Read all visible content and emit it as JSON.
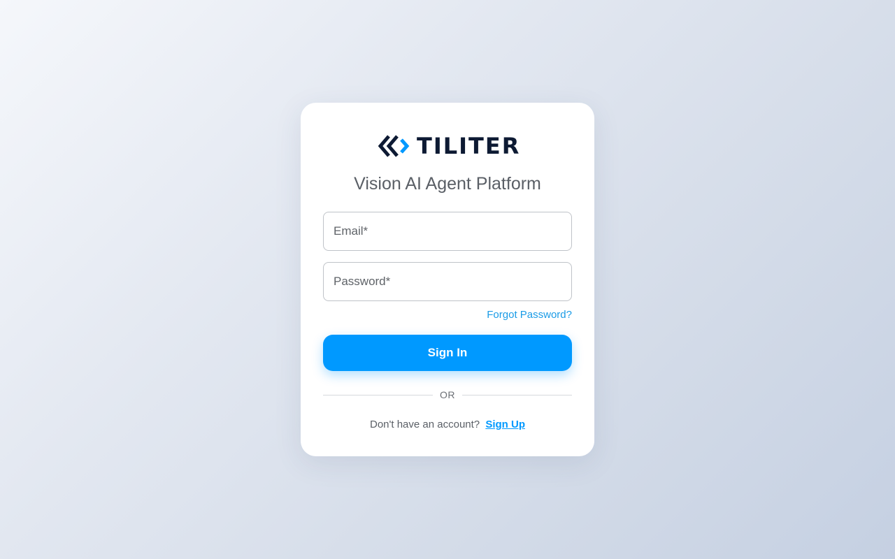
{
  "brand": {
    "name": "TILITER",
    "logo_icon": "chevrons-logo-icon",
    "color_dark": "#0d1a33",
    "color_accent": "#0099ff"
  },
  "login": {
    "subtitle": "Vision AI Agent Platform",
    "email_label": "Email*",
    "email_value": "",
    "password_label": "Password*",
    "password_value": "",
    "forgot_password": "Forgot Password?",
    "sign_in_button": "Sign In",
    "divider_text": "OR",
    "no_account_text": "Don't have an account?",
    "sign_up_link": "Sign Up"
  }
}
